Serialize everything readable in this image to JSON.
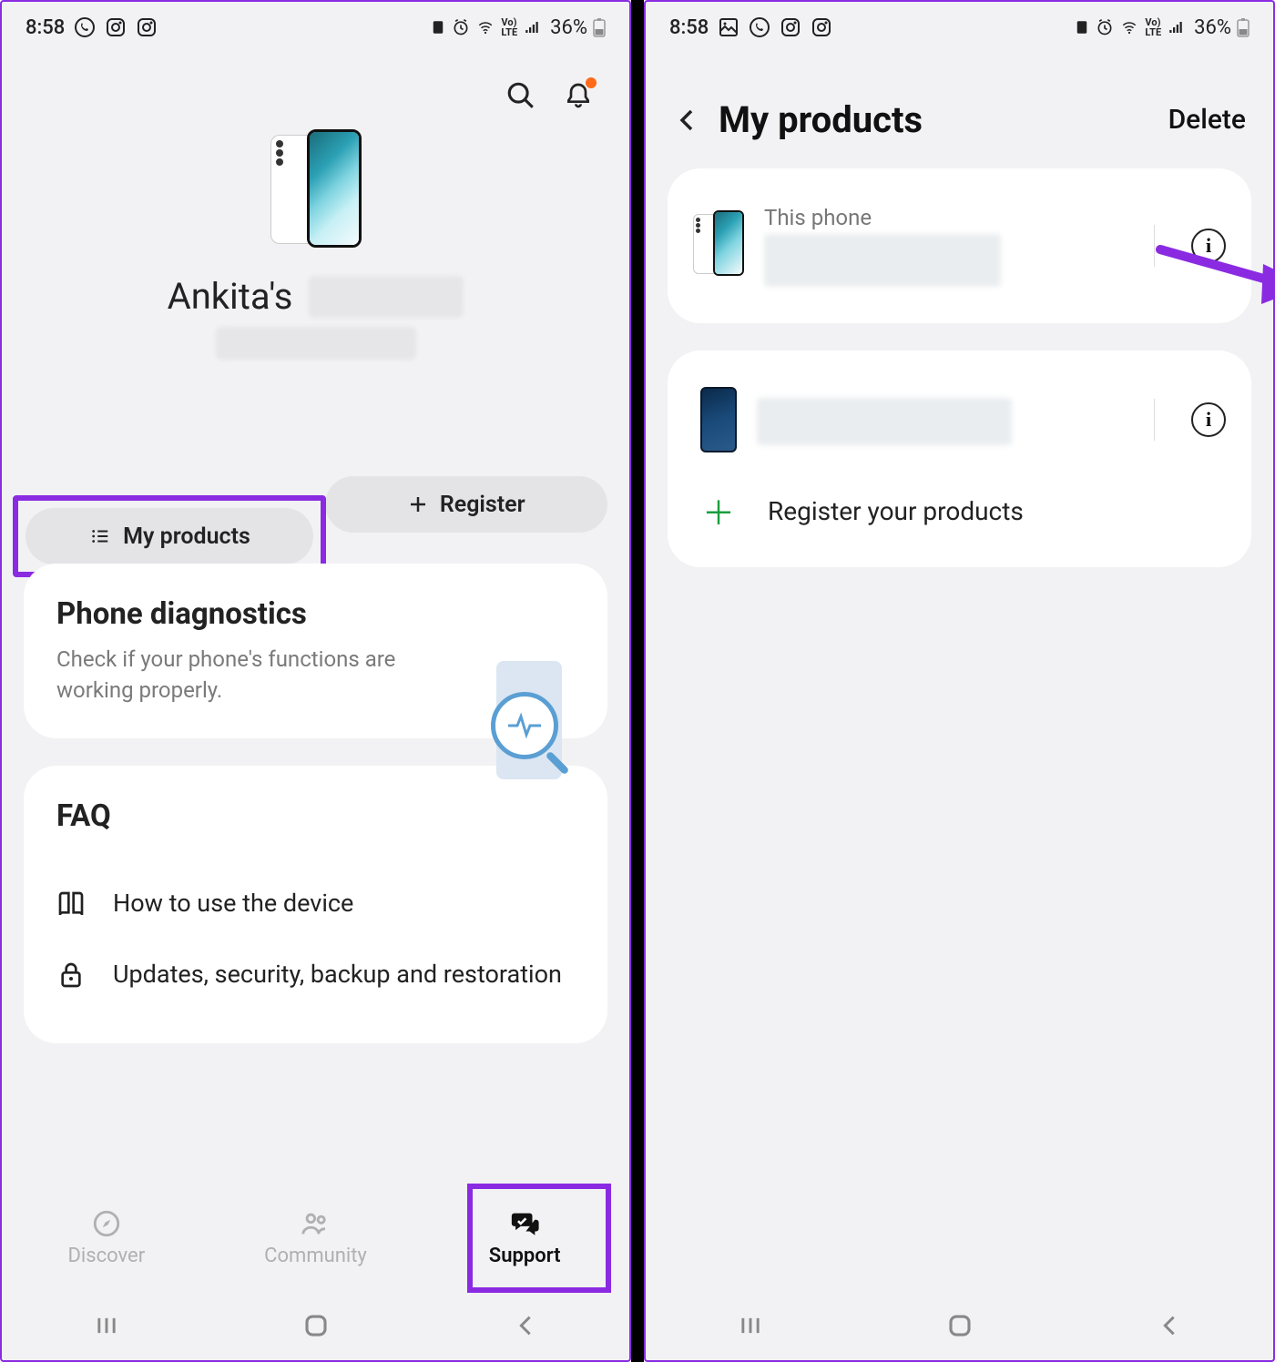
{
  "status": {
    "time": "8:58",
    "battery": "36%"
  },
  "left": {
    "owner_prefix": "Ankita's",
    "buttons": {
      "my_products": "My products",
      "register": "Register"
    },
    "diagnostics": {
      "title": "Phone diagnostics",
      "subtitle": "Check if your phone's functions are working properly."
    },
    "faq": {
      "title": "FAQ",
      "items": [
        {
          "label": "How to use the device"
        },
        {
          "label": "Updates, security, backup and restoration"
        }
      ]
    },
    "nav": {
      "discover": "Discover",
      "community": "Community",
      "support": "Support"
    }
  },
  "right": {
    "title": "My products",
    "delete": "Delete",
    "this_phone": "This phone",
    "register_row": "Register your products"
  }
}
